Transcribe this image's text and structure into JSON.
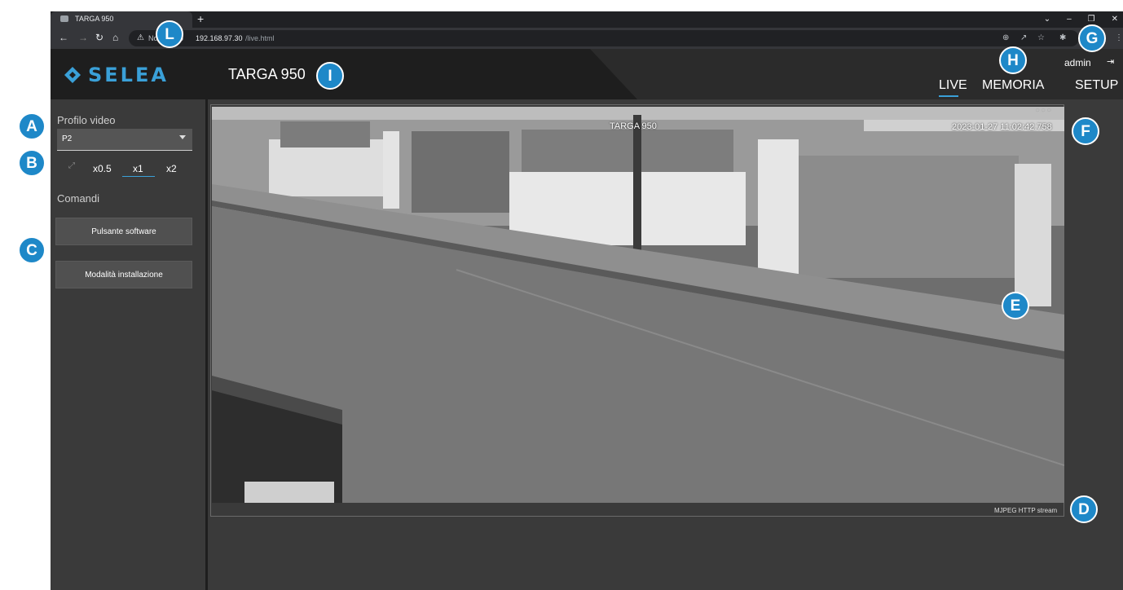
{
  "browser": {
    "tab_title": "TARGA 950",
    "new_tab": "+",
    "window_controls": [
      "⌄",
      "–",
      "❐",
      "✕"
    ],
    "url_security": "Non sicuro",
    "url_host": "192.168.97.30",
    "url_path": "/live.html"
  },
  "header": {
    "logo_text": "SELEA",
    "title": "TARGA 950",
    "user": "admin",
    "nav": [
      "LIVE",
      "MEMORIA",
      "SETUP"
    ],
    "active_nav": "LIVE"
  },
  "sidebar": {
    "profile_label": "Profilo video",
    "profile_value": "P2",
    "zoom_options": [
      "x0.5",
      "x1",
      "x2"
    ],
    "zoom_selected": "x1",
    "commands_label": "Comandi",
    "buttons": [
      "Pulsante software",
      "Modalità installazione"
    ]
  },
  "video": {
    "osd_title": "TARGA 950",
    "osd_timestamp": "2023-01-27 11:02:42.758",
    "stream_label": "MJPEG HTTP stream"
  },
  "callouts": [
    "A",
    "B",
    "C",
    "D",
    "E",
    "F",
    "G",
    "H",
    "I",
    "L"
  ],
  "colors": {
    "accent": "#3aa0d8",
    "callout": "#1e88c8",
    "panel": "#3a3a3a",
    "header": "#2b2b2b"
  }
}
